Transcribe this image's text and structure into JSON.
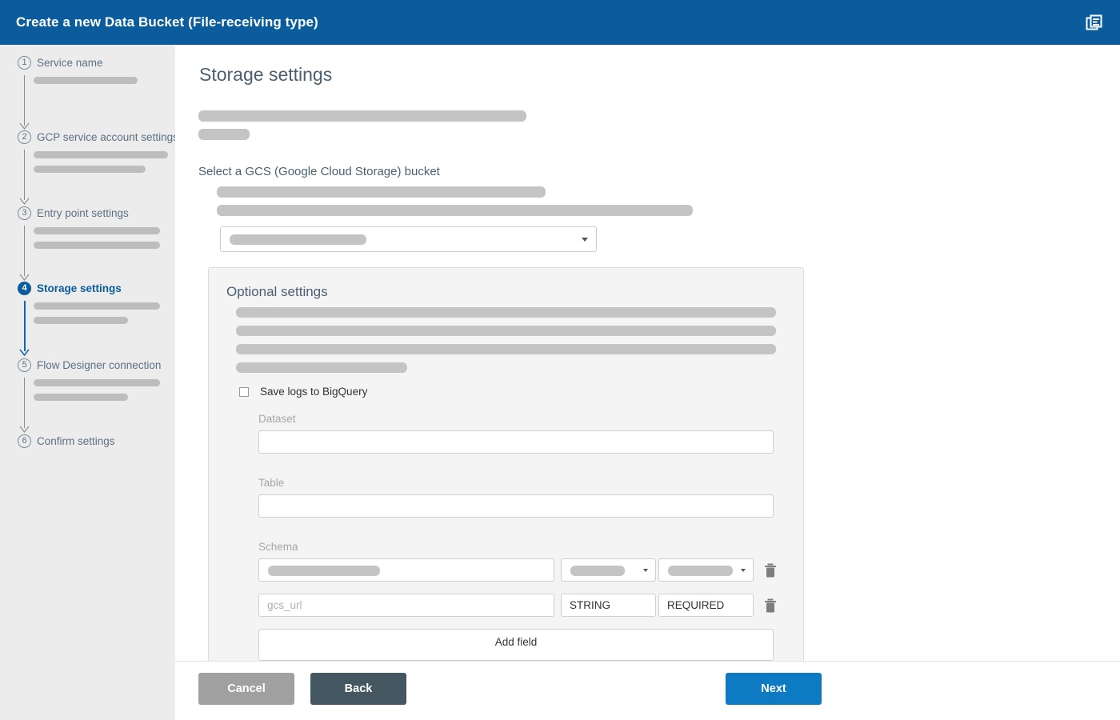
{
  "header": {
    "title": "Create a new Data Bucket (File-receiving type)",
    "icon": "copy-documents-icon",
    "bg_color": "#0a5c9c"
  },
  "sidebar": {
    "bg_color": "#ececec",
    "active_color": "#0a5c9c",
    "steps": [
      {
        "number": "1",
        "label": "Service name",
        "active": false,
        "bars": [
          130
        ]
      },
      {
        "number": "2",
        "label": "GCP service account settings",
        "active": false,
        "bars": [
          168,
          140
        ]
      },
      {
        "number": "3",
        "label": "Entry point settings",
        "active": false,
        "bars": [
          158,
          158
        ]
      },
      {
        "number": "4",
        "label": "Storage settings",
        "active": true,
        "bars": [
          158,
          118
        ]
      },
      {
        "number": "5",
        "label": "Flow Designer connection",
        "active": false,
        "bars": [
          158,
          118
        ]
      },
      {
        "number": "6",
        "label": "Confirm settings",
        "active": false,
        "bars": []
      }
    ]
  },
  "main": {
    "page_title": "Storage settings",
    "bucket_section_label": "Select a GCS (Google Cloud Storage) bucket",
    "bucket_select": {
      "value": "",
      "caret": "chevron-down-icon"
    },
    "optional": {
      "title": "Optional settings",
      "checkbox_label": "Save logs to BigQuery",
      "checkbox_checked": false,
      "dataset_label": "Dataset",
      "dataset_value": "",
      "table_label": "Table",
      "table_value": "",
      "schema_label": "Schema",
      "schema_rows": [
        {
          "name": "",
          "name_redacted": true,
          "type": "",
          "type_redacted": true,
          "mode": "",
          "mode_redacted": true,
          "delete_icon": "trash-icon"
        },
        {
          "name": "gcs_url",
          "name_redacted": false,
          "type": "STRING",
          "type_redacted": false,
          "mode": "REQUIRED",
          "mode_redacted": false,
          "delete_icon": "trash-icon"
        }
      ],
      "add_field_label": "Add field"
    }
  },
  "footer": {
    "cancel_label": "Cancel",
    "back_label": "Back",
    "next_label": "Next",
    "cancel_color": "#a0a0a0",
    "back_color": "#44565f",
    "next_color": "#0d7ac4"
  }
}
